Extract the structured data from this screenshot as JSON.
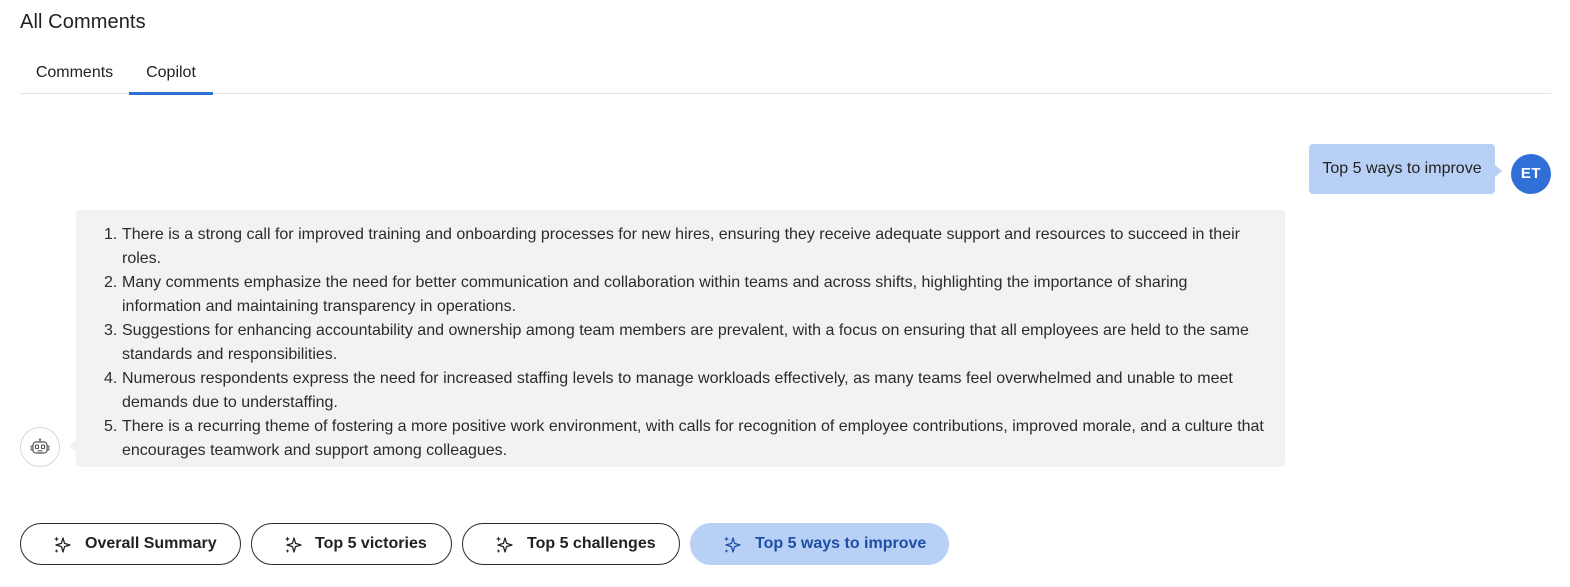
{
  "page": {
    "title": "All Comments"
  },
  "tabs": [
    {
      "label": "Comments",
      "active": false
    },
    {
      "label": "Copilot",
      "active": true
    }
  ],
  "conversation": {
    "user_message": "Top 5 ways to improve",
    "user_initials": "ET",
    "assistant_items": [
      "There is a strong call for improved training and onboarding processes for new hires, ensuring they receive adequate support and resources to succeed in their roles.",
      "Many comments emphasize the need for better communication and collaboration within teams and across shifts, highlighting the importance of sharing information and maintaining transparency in operations.",
      "Suggestions for enhancing accountability and ownership among team members are prevalent, with a focus on ensuring that all employees are held to the same standards and responsibilities.",
      "Numerous respondents express the need for increased staffing levels to manage workloads effectively, as many teams feel overwhelmed and unable to meet demands due to understaffing.",
      "There is a recurring theme of fostering a more positive work environment, with calls for recognition of employee contributions, improved morale, and a culture that encourages teamwork and support among colleagues."
    ],
    "assistant_icon": "robot-icon"
  },
  "prompt_chips": [
    {
      "label": "Overall Summary",
      "icon": "sparkle-icon",
      "selected": false
    },
    {
      "label": "Top 5 victories",
      "icon": "sparkle-icon",
      "selected": false
    },
    {
      "label": "Top 5 challenges",
      "icon": "sparkle-icon",
      "selected": false
    },
    {
      "label": "Top 5 ways to improve",
      "icon": "sparkle-icon",
      "selected": true
    }
  ],
  "colors": {
    "accent": "#2f6fd6",
    "user_bubble": "#b8d0f5",
    "assistant_bubble": "#f2f2f2",
    "selected_chip_text": "#1f4fa3"
  }
}
